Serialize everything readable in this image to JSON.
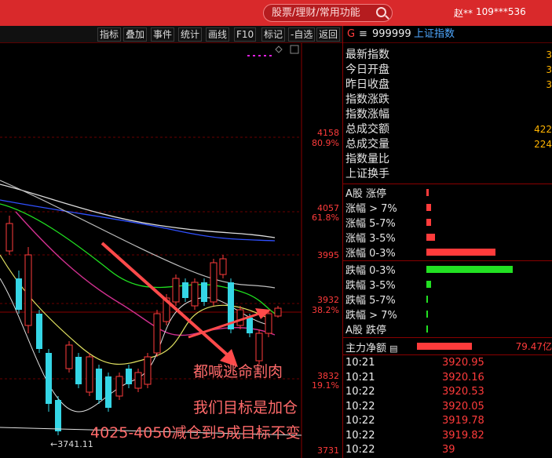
{
  "titlebar": {
    "search_placeholder": "股票/理财/常用功能",
    "user_name": "赵**",
    "user_id": "109***536"
  },
  "toolbar": {
    "buttons": [
      "指标",
      "叠加",
      "事件",
      "统计",
      "画线",
      "F10",
      "标记",
      "-自选",
      "返回"
    ]
  },
  "chart": {
    "price_labels": [
      {
        "price": "4158",
        "pct": "80.9%"
      },
      {
        "price": "4057",
        "pct": "61.8%"
      },
      {
        "price": "3995",
        "pct": ""
      },
      {
        "price": "3932",
        "pct": "38.2%"
      },
      {
        "price": "3832",
        "pct": "19.1%"
      },
      {
        "price": "3731",
        "pct": ""
      }
    ],
    "low_label": "←3741.11",
    "annotations": [
      "都喊逃命割肉",
      "我们目标是加仓",
      "4025-4050减仓到5成目标不变"
    ],
    "colors": {
      "up": "#ff3b3b",
      "down": "#35d6e6",
      "arrow": "#ff4a4a"
    }
  },
  "panel": {
    "header_marker": "G",
    "header_menu": "≡",
    "code": "999999",
    "name": "上证指数",
    "quote_rows": [
      {
        "label": "最新指数",
        "value": "3"
      },
      {
        "label": "今日开盘",
        "value": "3"
      },
      {
        "label": "昨日收盘",
        "value": "3"
      },
      {
        "label": "指数涨跌",
        "value": ""
      },
      {
        "label": "指数涨幅",
        "value": ""
      },
      {
        "label": "总成交额",
        "value": "422"
      },
      {
        "label": "总成交量",
        "value": "224"
      },
      {
        "label": "指数量比",
        "value": ""
      },
      {
        "label": "上证换手",
        "value": ""
      }
    ],
    "breadth_rows": [
      {
        "label": "A股 涨停",
        "fraction": 0.03,
        "color": "#ff3b3b"
      },
      {
        "label": "涨幅 > 7%",
        "fraction": 0.05,
        "color": "#ff3b3b"
      },
      {
        "label": "涨幅 5-7%",
        "fraction": 0.05,
        "color": "#ff3b3b"
      },
      {
        "label": "涨幅 3-5%",
        "fraction": 0.1,
        "color": "#ff3b3b"
      },
      {
        "label": "涨幅 0-3%",
        "fraction": 0.8,
        "color": "#ff3b3b"
      },
      {
        "label": "跌幅 0-3%",
        "fraction": 1.0,
        "color": "#22e022"
      },
      {
        "label": "跌幅 3-5%",
        "fraction": 0.05,
        "color": "#22e022"
      },
      {
        "label": "跌幅 5-7%",
        "fraction": 0.01,
        "color": "#22e022"
      },
      {
        "label": "跌幅 > 7%",
        "fraction": 0.01,
        "color": "#22e022"
      },
      {
        "label": "A股 跌停",
        "fraction": 0.01,
        "color": "#22e022"
      }
    ],
    "capital_flow": {
      "label": "主力净额",
      "value": "79.47亿",
      "fraction": 1.0
    },
    "ticks": [
      {
        "time": "10:21",
        "price": "3920.95"
      },
      {
        "time": "10:21",
        "price": "3920.16"
      },
      {
        "time": "10:22",
        "price": "3920.53"
      },
      {
        "time": "10:22",
        "price": "3920.05"
      },
      {
        "time": "10:22",
        "price": "3919.78"
      },
      {
        "time": "10:22",
        "price": "3919.82"
      },
      {
        "time": "10:22",
        "price": "39"
      }
    ]
  }
}
